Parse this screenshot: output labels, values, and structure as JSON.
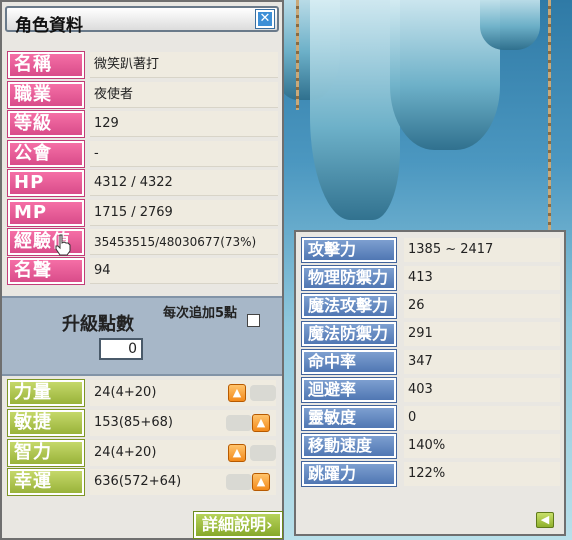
{
  "window": {
    "title": "角色資料"
  },
  "profile": [
    {
      "label": "名稱",
      "value": "微笑趴著打"
    },
    {
      "label": "職業",
      "value": "夜使者"
    },
    {
      "label": "等級",
      "value": "129"
    },
    {
      "label": "公會",
      "value": "-"
    },
    {
      "label": "HP",
      "value": "4312 / 4322"
    },
    {
      "label": "MP",
      "value": "1715 / 2769"
    },
    {
      "label": "經驗值",
      "value": "35453515/48030677(73%)"
    },
    {
      "label": "名聲",
      "value": "94"
    }
  ],
  "ability_points": {
    "label": "升級點數",
    "value": "0",
    "each_add_label": "每次追加5點"
  },
  "stats": [
    {
      "label": "力量",
      "value": "24(4+20)"
    },
    {
      "label": "敏捷",
      "value": "153(85+68)"
    },
    {
      "label": "智力",
      "value": "24(4+20)"
    },
    {
      "label": "幸運",
      "value": "636(572+64)"
    }
  ],
  "detail_button": {
    "label": "詳細說明›"
  },
  "detail_stats": [
    {
      "label": "攻擊力",
      "value": "1385 ~ 2417"
    },
    {
      "label": "物理防禦力",
      "value": "413"
    },
    {
      "label": "魔法攻擊力",
      "value": "26"
    },
    {
      "label": "魔法防禦力",
      "value": "291"
    },
    {
      "label": "命中率",
      "value": "347"
    },
    {
      "label": "迴避率",
      "value": "403"
    },
    {
      "label": "靈敏度",
      "value": "0"
    },
    {
      "label": "移動速度",
      "value": "140%"
    },
    {
      "label": "跳躍力",
      "value": "122%"
    }
  ],
  "colors": {
    "profile_label": "#e0508f",
    "stat_label": "#a8bf45",
    "detail_label": "#5a80ba",
    "panel_bg": "#e9e7e2"
  },
  "icons": {
    "close": "close-icon",
    "up_arrow": "up-arrow-icon",
    "back": "back-arrow-icon",
    "cursor": "hand-cursor-icon"
  }
}
